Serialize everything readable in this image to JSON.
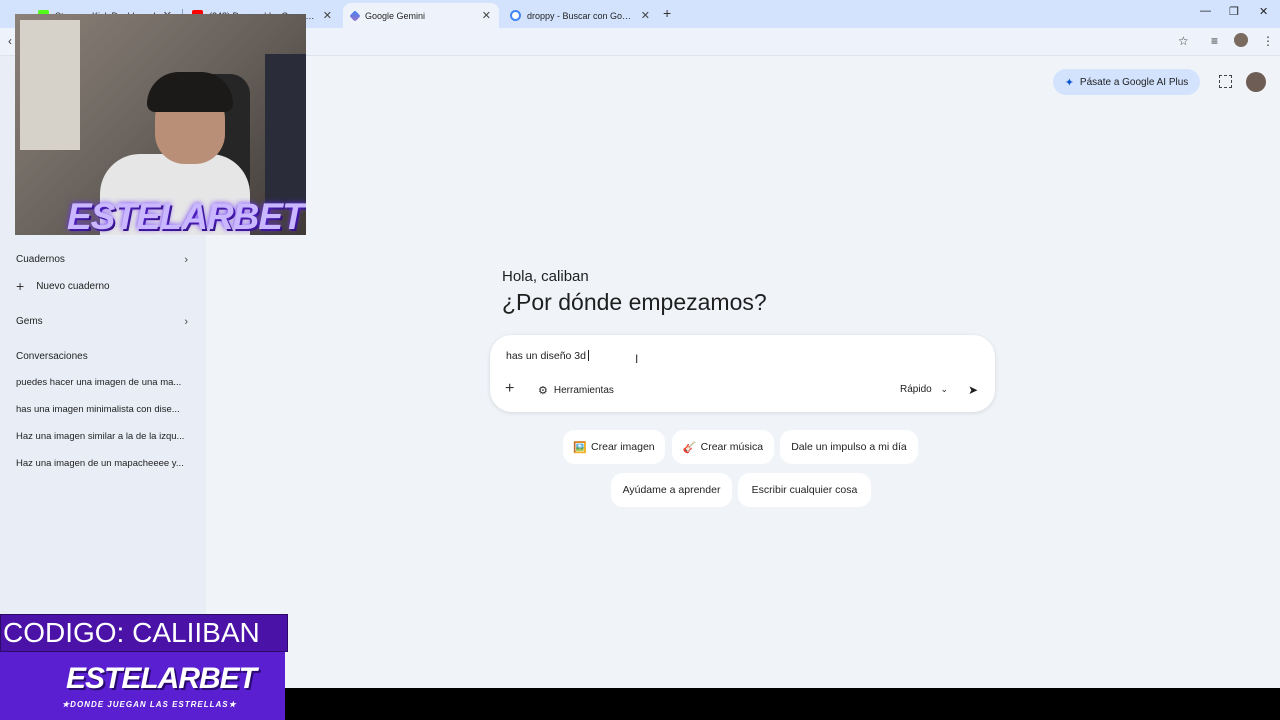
{
  "browser": {
    "tabs": [
      {
        "title": "Stream - Kick Dashboard",
        "favicon_color": "#53fc18"
      },
      {
        "title": "(248) Droppy | La Cacería | Lati",
        "favicon_color": "#ff0000"
      },
      {
        "title": "Google Gemini",
        "favicon_color": "#4285f4",
        "active": true
      },
      {
        "title": "droppy - Buscar con Google",
        "favicon_color": "#4285f4"
      }
    ],
    "new_tab_label": "+",
    "close_glyph": "✕"
  },
  "sidebar": {
    "notebooks_label": "Cuadernos",
    "new_notebook_label": "Nuevo cuaderno",
    "gems_label": "Gems",
    "conversations_label": "Conversaciones",
    "conversations": [
      "puedes hacer una imagen de una ma...",
      "has una imagen minimalista con dise...",
      "Haz una imagen similar a la de la izqu...",
      "Haz una imagen de un mapacheeee y..."
    ]
  },
  "header": {
    "upgrade_label": "Pásate a Google AI Plus"
  },
  "main": {
    "greeting": "Hola, caliban",
    "question": "¿Por dónde empezamos?",
    "composer": {
      "value": "has un diseño 3d",
      "tools_label": "Herramientas",
      "mode_label": "Rápido"
    },
    "chips": [
      {
        "emoji": "🖼️",
        "label": "Crear imagen"
      },
      {
        "emoji": "🎸",
        "label": "Crear música"
      },
      {
        "emoji": "",
        "label": "Dale un impulso a mi día"
      },
      {
        "emoji": "",
        "label": "Ayúdame a aprender"
      },
      {
        "emoji": "",
        "label": "Escribir cualquier cosa"
      }
    ]
  },
  "overlay": {
    "webcam_brand": "ESTELARBET",
    "code_text": "CODIGO: CALIIBAN",
    "promo_brand": "ESTELARBET",
    "promo_tagline": "★DONDE JUEGAN LAS ESTRELLAS★"
  },
  "colors": {
    "background": "#f0f4f9",
    "sidebar": "#e9eef6",
    "accent": "#d3e3fd",
    "overlay_purple": "#4b12a8"
  }
}
